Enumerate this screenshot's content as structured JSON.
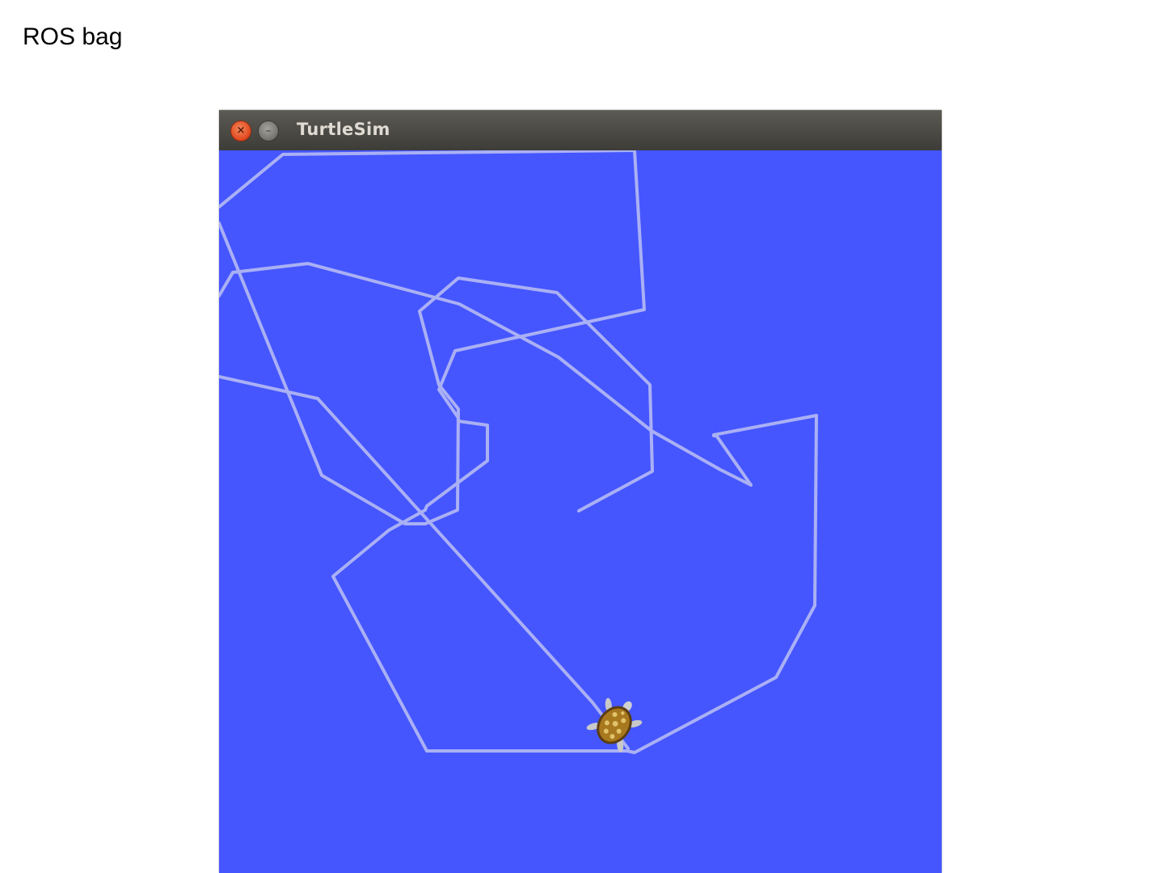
{
  "slide": {
    "title": "ROS bag"
  },
  "window": {
    "title": "TurtleSim",
    "close_glyph": "×",
    "minimize_glyph": "–",
    "close_icon": "close-icon",
    "minimize_icon": "minimize-icon"
  },
  "colors": {
    "background": "#4556ff",
    "pen": "#aab0f4",
    "titlebar": "#4a4944",
    "close_button": "#e5511f"
  }
}
